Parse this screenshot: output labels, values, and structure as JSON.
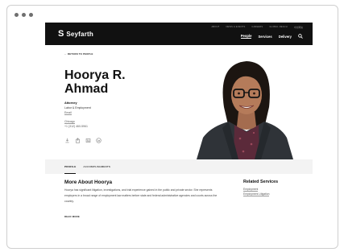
{
  "window": {
    "dot_color": "#6f6f6f"
  },
  "header": {
    "logo_mark": "S",
    "logo_text": "Seyfarth",
    "utility_nav": [
      "ABOUT",
      "NEWS & EVENTS",
      "CAREERS",
      "GLOBAL REACH",
      "中文网站"
    ],
    "main_nav": [
      {
        "label": "People",
        "active": true
      },
      {
        "label": "Services",
        "active": false
      },
      {
        "label": "Delivery",
        "active": false
      }
    ]
  },
  "profile": {
    "back_link": "← RETURN TO PEOPLE",
    "name_line1": "Hoorya R.",
    "name_line2": "Ahmad",
    "title": "Attorney",
    "practice": "Labor & Employment",
    "email_label": "Email",
    "office": "Chicago",
    "phone": "+1 (312) 460-5961"
  },
  "profile_actions": [
    "download-icon",
    "share-icon",
    "vcard-icon",
    "linkedin-icon"
  ],
  "tabs": [
    {
      "label": "PROFILE",
      "active": true
    },
    {
      "label": "ACCOMPLISHMENTS",
      "active": false
    }
  ],
  "about": {
    "heading": "More About Hoorya",
    "bio": "Hoorya has significant litigation, investigations, and trial experience gained in the public and private sector. She represents employers in a broad range of employment law matters before state and federal administrative agencies and courts across the country.",
    "read_more": "READ MORE"
  },
  "related": {
    "heading": "Related Services",
    "items": [
      "Employment",
      "Employment Litigation"
    ]
  },
  "colors": {
    "header_bg": "#111111",
    "tabs_bg": "#f3f3f3",
    "text": "#111111"
  }
}
